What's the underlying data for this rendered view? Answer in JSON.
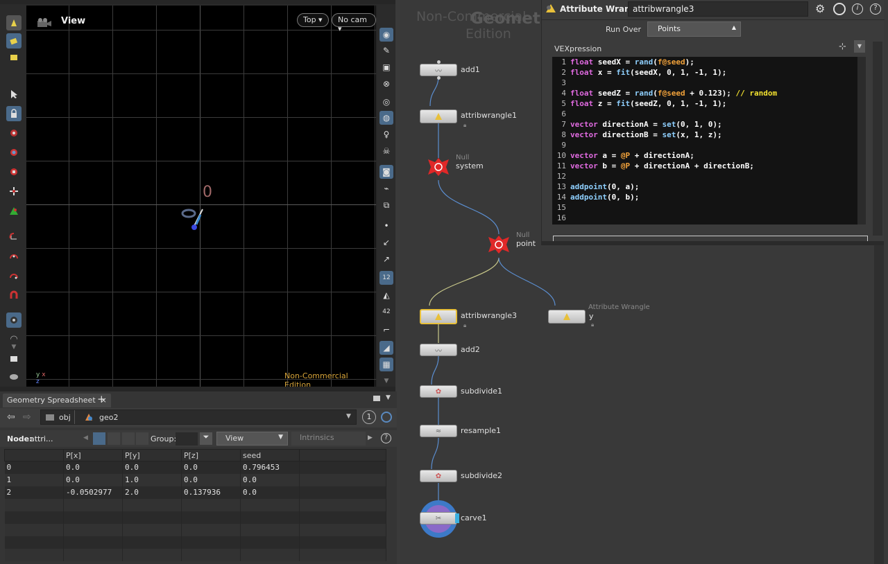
{
  "viewport": {
    "title": "View",
    "top_button": "Top",
    "cam_button": "No cam",
    "watermark": "Non-Commercial Edition",
    "point_label": "0",
    "axis_labels": [
      "y",
      "x",
      "z"
    ]
  },
  "spreadsheet": {
    "tab_label": "Geometry Spreadsheet",
    "tab_close": "×",
    "add_tab": "+",
    "path_obj": "obj",
    "path_geo": "geo2",
    "pin_number": "1",
    "node_label": "Node:",
    "node_value": "attri...",
    "group_label": "Group:",
    "view_select": "View",
    "intrinsics": "Intrinsics",
    "columns": [
      "",
      "P[x]",
      "P[y]",
      "P[z]",
      "seed"
    ],
    "rows": [
      [
        "0",
        "0.0",
        "0.0",
        "0.0",
        "0.796453"
      ],
      [
        "1",
        "0.0",
        "1.0",
        "0.0",
        "0.0"
      ],
      [
        "2",
        "-0.0502977",
        "2.0",
        "0.137936",
        "0.0"
      ]
    ]
  },
  "network": {
    "watermark_1": "Non-Commercial",
    "watermark_2": "Edition",
    "watermark_big": "Geometry",
    "nodes": {
      "add1": "add1",
      "attribwrangle1": "attribwrangle1",
      "null_system_type": "Null",
      "null_system": "system",
      "null_point_type": "Null",
      "null_point": "point",
      "attribwrangle3": "attribwrangle3",
      "wrangle_y_type": "Attribute Wrangle",
      "wrangle_y": "y",
      "add2": "add2",
      "subdivide1": "subdivide1",
      "resample1": "resample1",
      "subdivide2": "subdivide2",
      "carve1": "carve1"
    }
  },
  "params": {
    "node_type": "Attribute Wrangle",
    "node_name": "attribwrangle3",
    "run_over_label": "Run Over",
    "run_over_value": "Points",
    "vexpression_label": "VEXpression"
  }
}
